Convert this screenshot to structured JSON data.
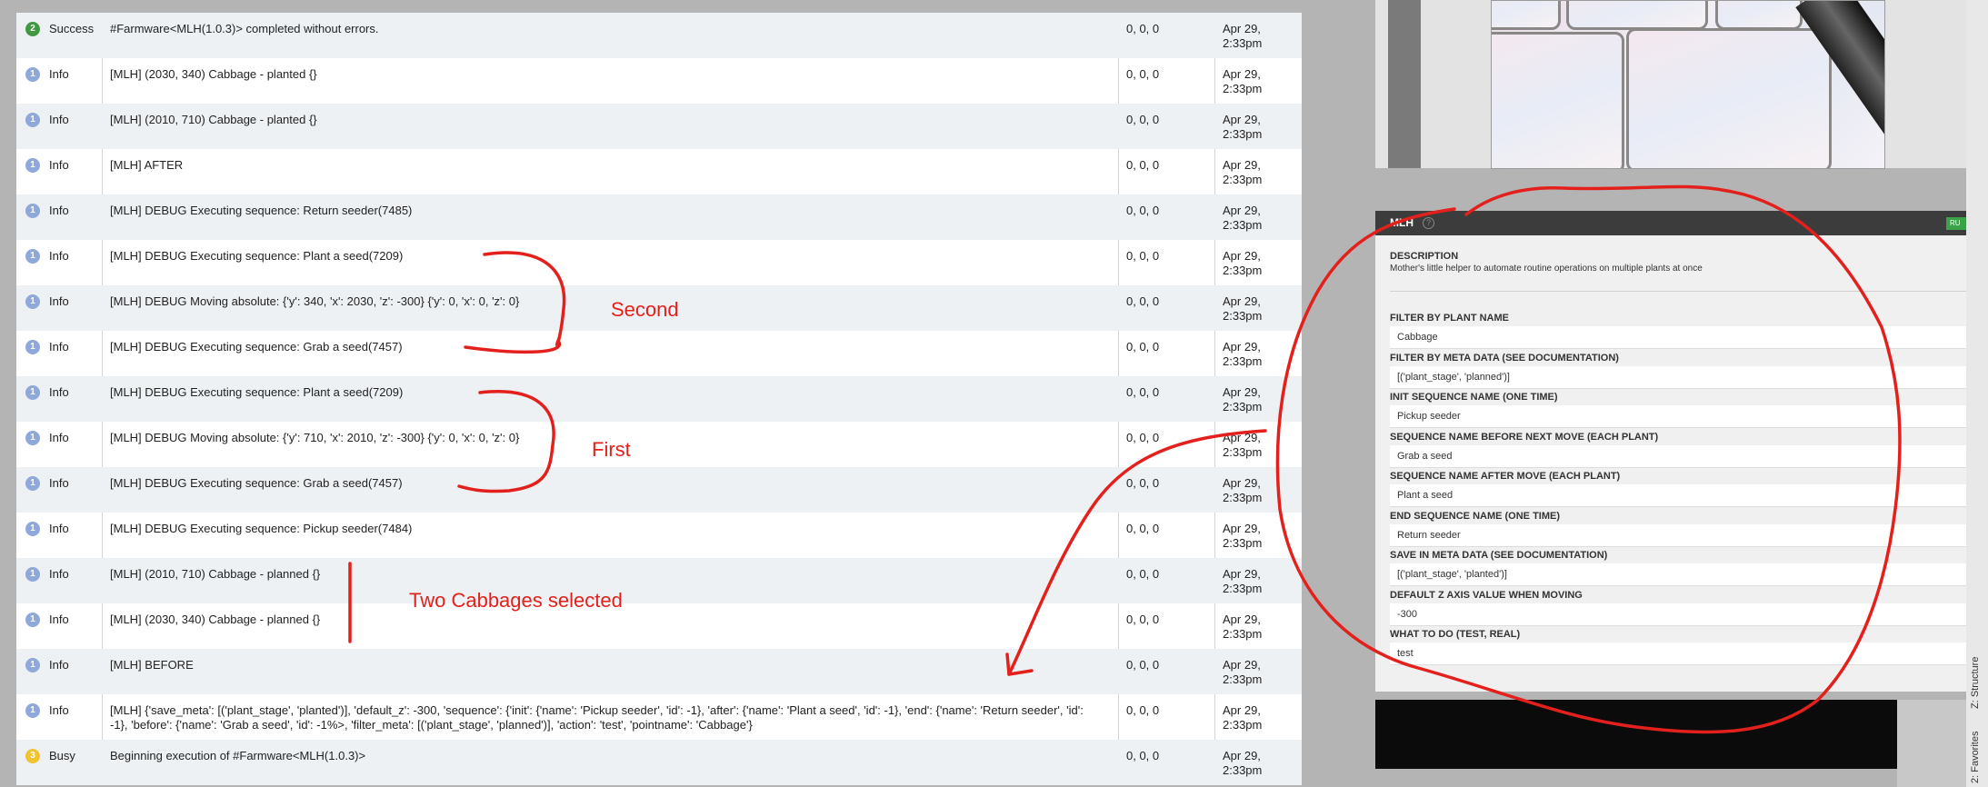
{
  "logs": {
    "rows": [
      {
        "badge": "2",
        "type": "Success",
        "message": "#Farmware<MLH(1.0.3)> completed without errors.",
        "position": "0, 0, 0",
        "date": "Apr 29,",
        "time": "2:33pm",
        "badge_kind": "success"
      },
      {
        "badge": "1",
        "type": "Info",
        "message": "[MLH] (2030, 340) Cabbage - planted {}",
        "position": "0, 0, 0",
        "date": "Apr 29,",
        "time": "2:33pm",
        "badge_kind": "info"
      },
      {
        "badge": "1",
        "type": "Info",
        "message": "[MLH] (2010, 710) Cabbage - planted {}",
        "position": "0, 0, 0",
        "date": "Apr 29,",
        "time": "2:33pm",
        "badge_kind": "info"
      },
      {
        "badge": "1",
        "type": "Info",
        "message": "[MLH] AFTER",
        "position": "0, 0, 0",
        "date": "Apr 29,",
        "time": "2:33pm",
        "badge_kind": "info"
      },
      {
        "badge": "1",
        "type": "Info",
        "message": "[MLH] DEBUG Executing sequence: Return seeder(7485)",
        "position": "0, 0, 0",
        "date": "Apr 29,",
        "time": "2:33pm",
        "badge_kind": "info"
      },
      {
        "badge": "1",
        "type": "Info",
        "message": "[MLH] DEBUG Executing sequence: Plant a seed(7209)",
        "position": "0, 0, 0",
        "date": "Apr 29,",
        "time": "2:33pm",
        "badge_kind": "info"
      },
      {
        "badge": "1",
        "type": "Info",
        "message": "[MLH] DEBUG Moving absolute: {'y': 340, 'x': 2030, 'z': -300} {'y': 0, 'x': 0, 'z': 0}",
        "position": "0, 0, 0",
        "date": "Apr 29,",
        "time": "2:33pm",
        "badge_kind": "info"
      },
      {
        "badge": "1",
        "type": "Info",
        "message": "[MLH] DEBUG Executing sequence: Grab a seed(7457)",
        "position": "0, 0, 0",
        "date": "Apr 29,",
        "time": "2:33pm",
        "badge_kind": "info"
      },
      {
        "badge": "1",
        "type": "Info",
        "message": "[MLH] DEBUG Executing sequence: Plant a seed(7209)",
        "position": "0, 0, 0",
        "date": "Apr 29,",
        "time": "2:33pm",
        "badge_kind": "info"
      },
      {
        "badge": "1",
        "type": "Info",
        "message": "[MLH] DEBUG Moving absolute: {'y': 710, 'x': 2010, 'z': -300} {'y': 0, 'x': 0, 'z': 0}",
        "position": "0, 0, 0",
        "date": "Apr 29,",
        "time": "2:33pm",
        "badge_kind": "info"
      },
      {
        "badge": "1",
        "type": "Info",
        "message": "[MLH] DEBUG Executing sequence: Grab a seed(7457)",
        "position": "0, 0, 0",
        "date": "Apr 29,",
        "time": "2:33pm",
        "badge_kind": "info"
      },
      {
        "badge": "1",
        "type": "Info",
        "message": "[MLH] DEBUG Executing sequence: Pickup seeder(7484)",
        "position": "0, 0, 0",
        "date": "Apr 29,",
        "time": "2:33pm",
        "badge_kind": "info"
      },
      {
        "badge": "1",
        "type": "Info",
        "message": "[MLH] (2010, 710) Cabbage - planned {}",
        "position": "0, 0, 0",
        "date": "Apr 29,",
        "time": "2:33pm",
        "badge_kind": "info"
      },
      {
        "badge": "1",
        "type": "Info",
        "message": "[MLH] (2030, 340) Cabbage - planned {}",
        "position": "0, 0, 0",
        "date": "Apr 29,",
        "time": "2:33pm",
        "badge_kind": "info"
      },
      {
        "badge": "1",
        "type": "Info",
        "message": "[MLH] BEFORE",
        "position": "0, 0, 0",
        "date": "Apr 29,",
        "time": "2:33pm",
        "badge_kind": "info"
      },
      {
        "badge": "1",
        "type": "Info",
        "message": "[MLH] {'save_meta': [('plant_stage', 'planted')], 'default_z': -300, 'sequence': {'init': {'name': 'Pickup seeder', 'id': -1}, 'after': {'name': 'Plant a seed', 'id': -1}, 'end': {'name': 'Return seeder', 'id': -1}, 'before': {'name': 'Grab a seed', 'id': -1%>, 'filter_meta': [('plant_stage', 'planned')], 'action': 'test', 'pointname': 'Cabbage'}",
        "position": "0, 0, 0",
        "date": "Apr 29,",
        "time": "2:33pm",
        "badge_kind": "info"
      },
      {
        "badge": "3",
        "type": "Busy",
        "message": "Beginning execution of #Farmware<MLH(1.0.3)>",
        "position": "0, 0, 0",
        "date": "Apr 29,",
        "time": "2:33pm",
        "badge_kind": "busy"
      }
    ]
  },
  "panel": {
    "title": "MLH",
    "help_icon": "?",
    "run_label": "RU",
    "description_label": "DESCRIPTION",
    "description": "Mother's little helper to automate routine operations on multiple plants at once",
    "fields": [
      {
        "label": "FILTER BY PLANT NAME",
        "value": "Cabbage"
      },
      {
        "label": "FILTER BY META DATA (SEE DOCUMENTATION)",
        "value": "[('plant_stage', 'planned')]"
      },
      {
        "label": "INIT SEQUENCE NAME (ONE TIME)",
        "value": "Pickup seeder"
      },
      {
        "label": "SEQUENCE NAME BEFORE NEXT MOVE (EACH PLANT)",
        "value": "Grab a seed"
      },
      {
        "label": "SEQUENCE NAME AFTER MOVE (EACH PLANT)",
        "value": "Plant a seed"
      },
      {
        "label": "END SEQUENCE NAME (ONE TIME)",
        "value": "Return seeder"
      },
      {
        "label": "SAVE IN META DATA (SEE DOCUMENTATION)",
        "value": "[('plant_stage', 'planted')]"
      },
      {
        "label": "DEFAULT Z AXIS VALUE WHEN MOVING",
        "value": "-300"
      },
      {
        "label": "WHAT TO DO (TEST, REAL)",
        "value": "test"
      }
    ]
  },
  "annotations": {
    "second": "Second",
    "first": "First",
    "two_cabbages": "Two Cabbages selected",
    "ink_color": "#e3201b"
  },
  "side_tabs": {
    "structure": "Z: Structure",
    "favorites": "2: Favorites"
  },
  "colors": {
    "info_badge": "#8ea8da",
    "success_badge": "#3f9a3f",
    "busy_badge": "#f0c430",
    "alt_row": "#eef1f4"
  }
}
